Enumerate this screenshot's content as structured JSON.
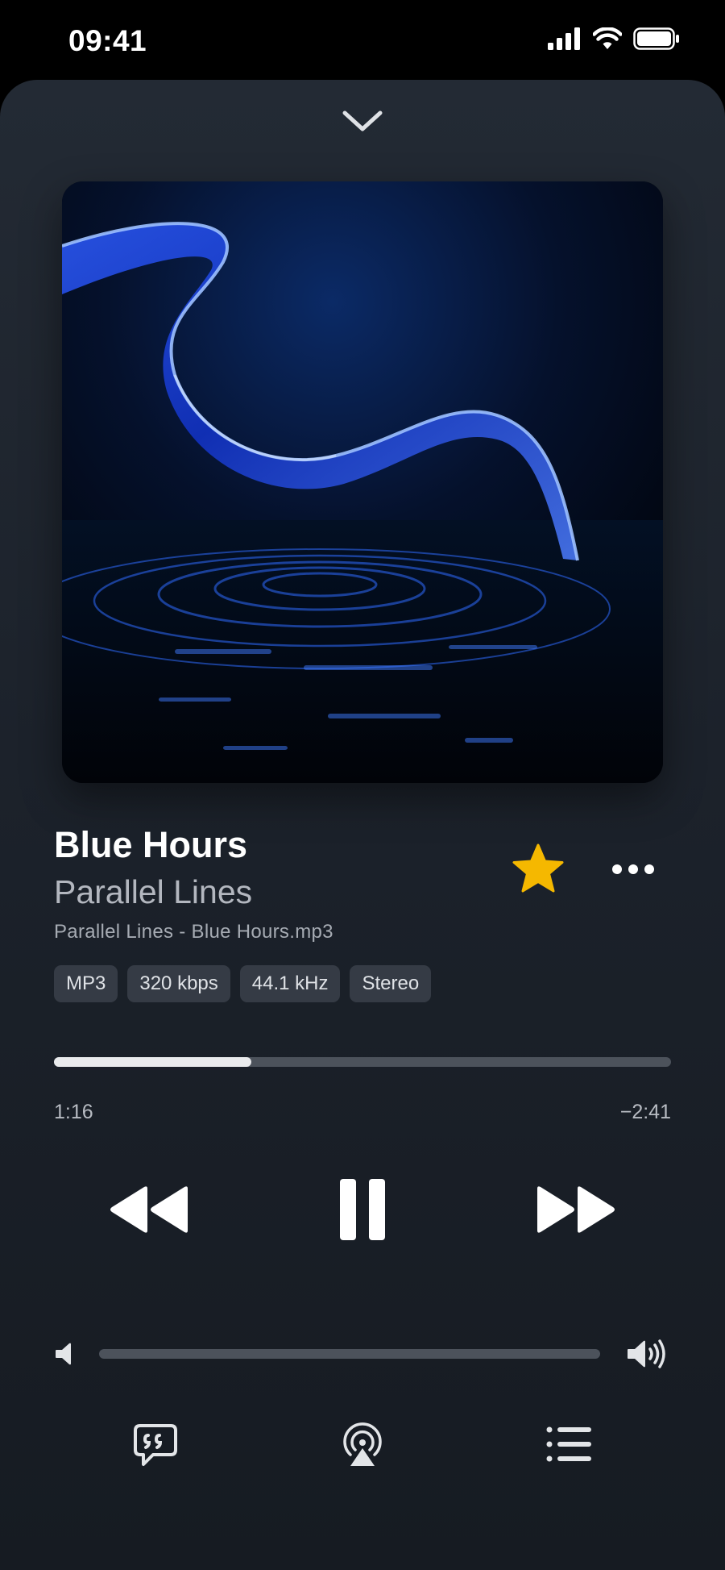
{
  "status_bar": {
    "time": "09:41"
  },
  "track": {
    "title": "Blue Hours",
    "artist": "Parallel Lines",
    "filename": "Parallel Lines - Blue Hours.mp3",
    "favorite": true,
    "tags": [
      "MP3",
      "320 kbps",
      "44.1 kHz",
      "Stereo"
    ]
  },
  "playback": {
    "elapsed": "1:16",
    "remaining": "−2:41",
    "progress_fraction": 0.32,
    "state": "playing"
  },
  "volume": {
    "level_fraction": 0.0
  },
  "icons": {
    "collapse": "chevron-down-icon",
    "favorite": "star-icon",
    "more": "more-icon",
    "rewind": "rewind-icon",
    "pause": "pause-icon",
    "forward": "fast-forward-icon",
    "volume_low": "volume-low-icon",
    "volume_high": "volume-high-icon",
    "lyrics": "lyrics-icon",
    "airplay": "airplay-icon",
    "queue": "queue-icon"
  },
  "colors": {
    "accent_star": "#F5B800",
    "sheet_background": "#1F252E",
    "text_primary": "#FFFFFF",
    "text_secondary": "#B3B7BF",
    "track": "#4C525B",
    "track_fill": "#E9EAEC"
  }
}
